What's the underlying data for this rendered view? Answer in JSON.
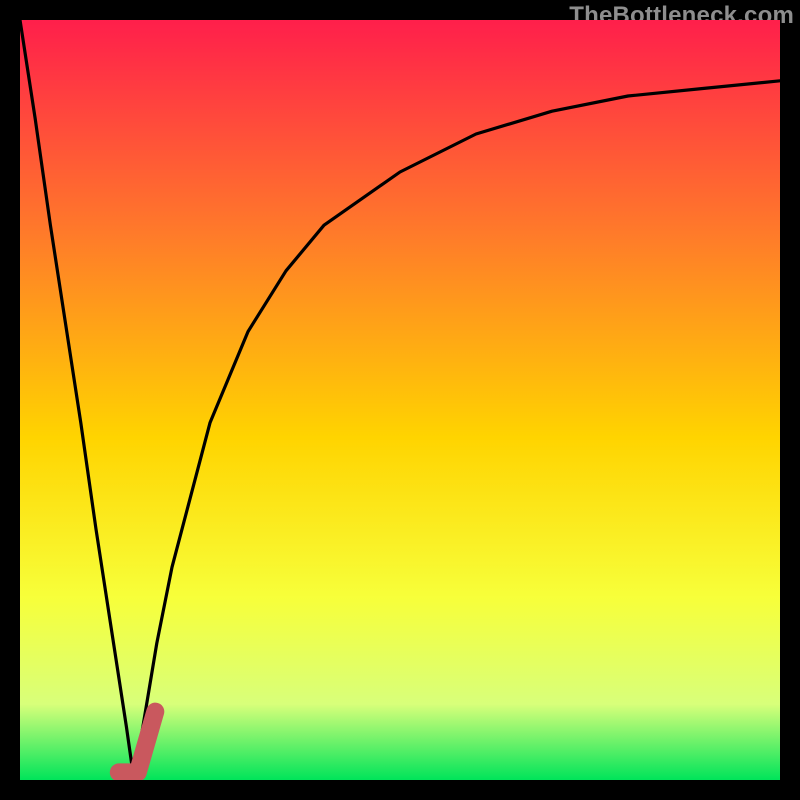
{
  "watermark": "TheBottleneck.com",
  "colors": {
    "gradient_top": "#ff1f4b",
    "gradient_mid_upper": "#ff7a2a",
    "gradient_mid": "#ffd400",
    "gradient_mid_lower": "#f7ff3a",
    "gradient_lower": "#d8ff7a",
    "gradient_bottom": "#00e45a",
    "curve": "#000000",
    "marker": "#c9585e"
  },
  "chart_data": {
    "type": "line",
    "title": "",
    "xlabel": "",
    "ylabel": "",
    "x": [
      0,
      2,
      4,
      6,
      8,
      10,
      12,
      14,
      15,
      16,
      18,
      20,
      25,
      30,
      35,
      40,
      50,
      60,
      70,
      80,
      90,
      100
    ],
    "values": [
      100,
      87,
      73,
      60,
      47,
      33,
      20,
      7,
      0,
      6,
      18,
      28,
      47,
      59,
      67,
      73,
      80,
      85,
      88,
      90,
      91,
      92
    ],
    "xlim": [
      0,
      100
    ],
    "ylim": [
      0,
      100
    ],
    "marker": {
      "shape": "J",
      "x_start": 14.2,
      "y_start": 1,
      "x_end": 17.8,
      "y_end": 9
    },
    "grid": false,
    "legend": false
  }
}
